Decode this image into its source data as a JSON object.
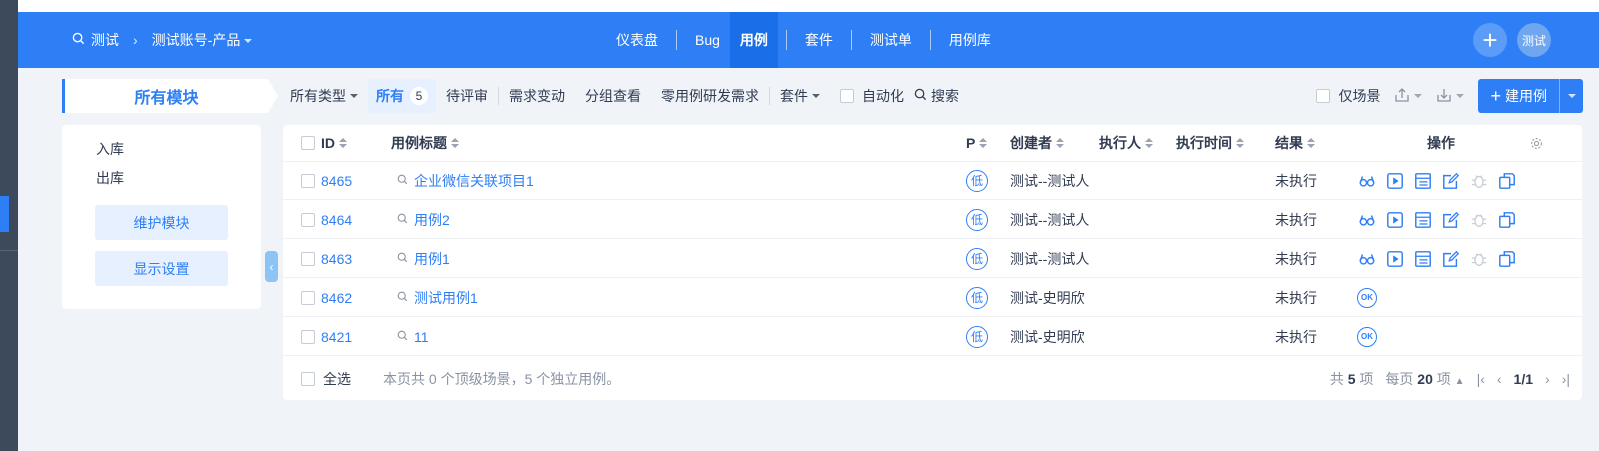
{
  "header": {
    "breadcrumb": {
      "product": "测试",
      "branch": "测试账号-产品"
    },
    "nav": [
      "仪表盘",
      "Bug",
      "用例",
      "套件",
      "测试单",
      "用例库"
    ],
    "active_nav": "用例",
    "add_symbol": "+",
    "avatar": "测试"
  },
  "sidebar": {
    "tab_label": "所有模块",
    "modules": [
      "入库",
      "出库"
    ],
    "maintain_button": "维护模块",
    "display_button": "显示设置"
  },
  "filters": {
    "all_types": "所有类型",
    "all": "所有",
    "all_count": "5",
    "pending_review": "待评审",
    "need_change": "需求变动",
    "group_view": "分组查看",
    "zero_case": "零用例研发需求",
    "suite": "套件",
    "automation": "自动化",
    "search": "搜索",
    "only_scene": "仅场景",
    "create_case": "建用例"
  },
  "table": {
    "columns": {
      "id": "ID",
      "title": "用例标题",
      "pri": "P",
      "creator": "创建者",
      "executor": "执行人",
      "exec_time": "执行时间",
      "result": "结果",
      "actions": "操作"
    },
    "rows": [
      {
        "id": "8465",
        "title": "企业微信关联项目1",
        "pri": "低",
        "creator": "测试--测试人",
        "result": "未执行",
        "full_actions": true
      },
      {
        "id": "8464",
        "title": "用例2",
        "pri": "低",
        "creator": "测试--测试人",
        "result": "未执行",
        "full_actions": true
      },
      {
        "id": "8463",
        "title": "用例1",
        "pri": "低",
        "creator": "测试--测试人",
        "result": "未执行",
        "full_actions": true
      },
      {
        "id": "8462",
        "title": "测试用例1",
        "pri": "低",
        "creator": "测试-史明欣",
        "result": "未执行",
        "full_actions": false
      },
      {
        "id": "8421",
        "title": "11",
        "pri": "低",
        "creator": "测试-史明欣",
        "result": "未执行",
        "full_actions": false
      }
    ],
    "ok_label": "OK"
  },
  "footer": {
    "select_all": "全选",
    "summary": "本页共 0 个顶级场景，5 个独立用例。",
    "total_prefix": "共",
    "total": "5",
    "total_suffix": "项",
    "per_page_prefix": "每页",
    "per_page": "20",
    "per_page_suffix": "项",
    "page": "1/1"
  }
}
